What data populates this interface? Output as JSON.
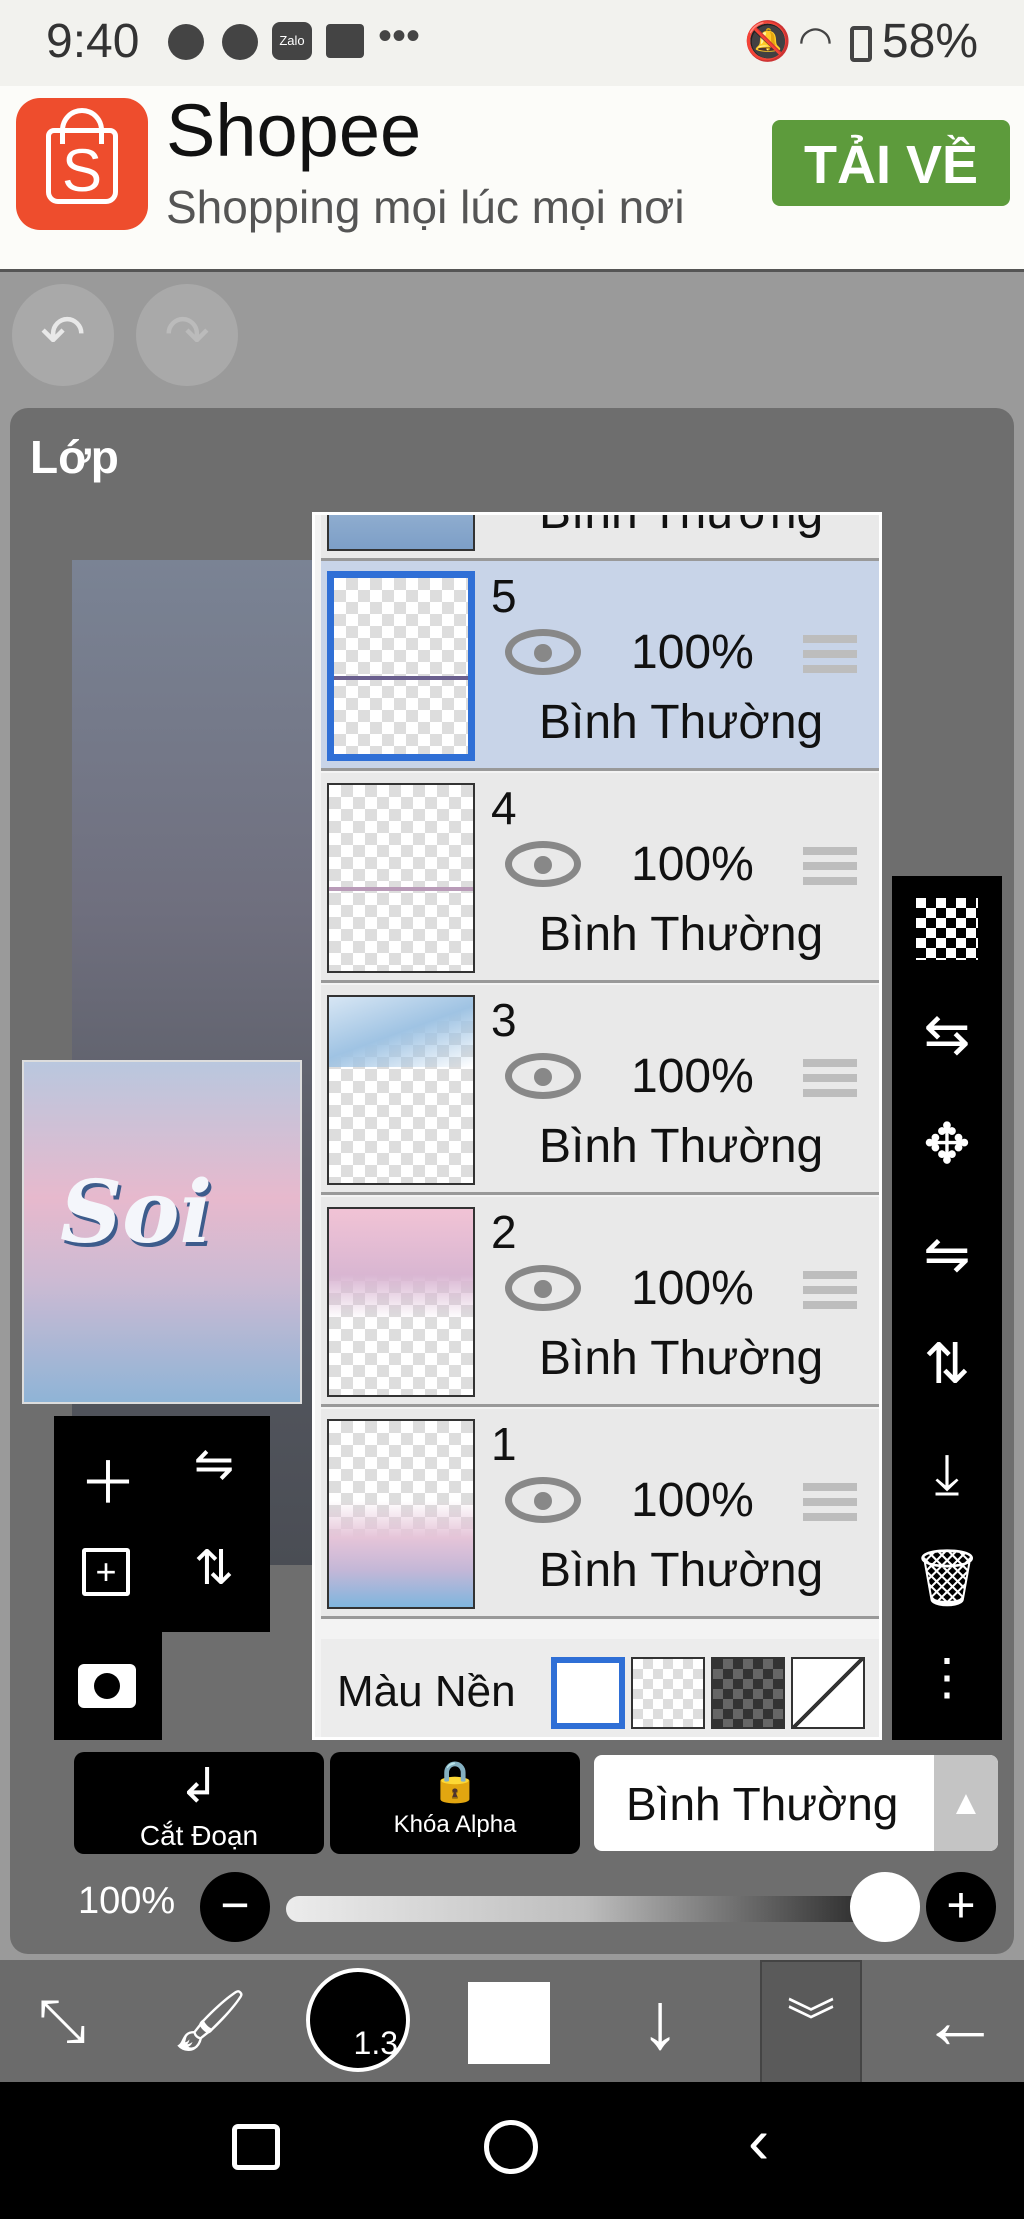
{
  "status_bar": {
    "time": "9:40",
    "battery": "58%",
    "icons": [
      "messenger-icon",
      "chat-icon",
      "zalo-icon",
      "gallery-icon",
      "more-icon",
      "mute-icon",
      "wifi-icon",
      "battery-icon"
    ],
    "zalo_text": "Zalo"
  },
  "ad": {
    "brand": "Shopee",
    "tagline": "Shopping mọi lúc mọi nơi",
    "cta": "TẢI VỀ",
    "logo_letter": "S",
    "brand_color": "#ee4d2d",
    "cta_color": "#5d9b3c"
  },
  "panel": {
    "title": "Lớp"
  },
  "thumbnail": {
    "word": "Soi"
  },
  "layers": [
    {
      "number": "5",
      "opacity": "100%",
      "blend": "Bình Thường",
      "selected": true
    },
    {
      "number": "4",
      "opacity": "100%",
      "blend": "Bình Thường",
      "selected": false
    },
    {
      "number": "3",
      "opacity": "100%",
      "blend": "Bình Thường",
      "selected": false
    },
    {
      "number": "2",
      "opacity": "100%",
      "blend": "Bình Thường",
      "selected": false
    },
    {
      "number": "1",
      "opacity": "100%",
      "blend": "Bình Thường",
      "selected": false
    }
  ],
  "partial_layer_blend": "Bình Thường",
  "background_row": {
    "label": "Màu Nền"
  },
  "buttons": {
    "clip": "Cắt Đoạn",
    "alpha_lock": "Khóa Alpha",
    "blend_mode": "Bình Thường"
  },
  "opacity_control": {
    "label": "100%",
    "value_fraction": 1.0
  },
  "toolbar": {
    "brush_size": "1.3"
  },
  "accent_color": "#2f6fd6"
}
